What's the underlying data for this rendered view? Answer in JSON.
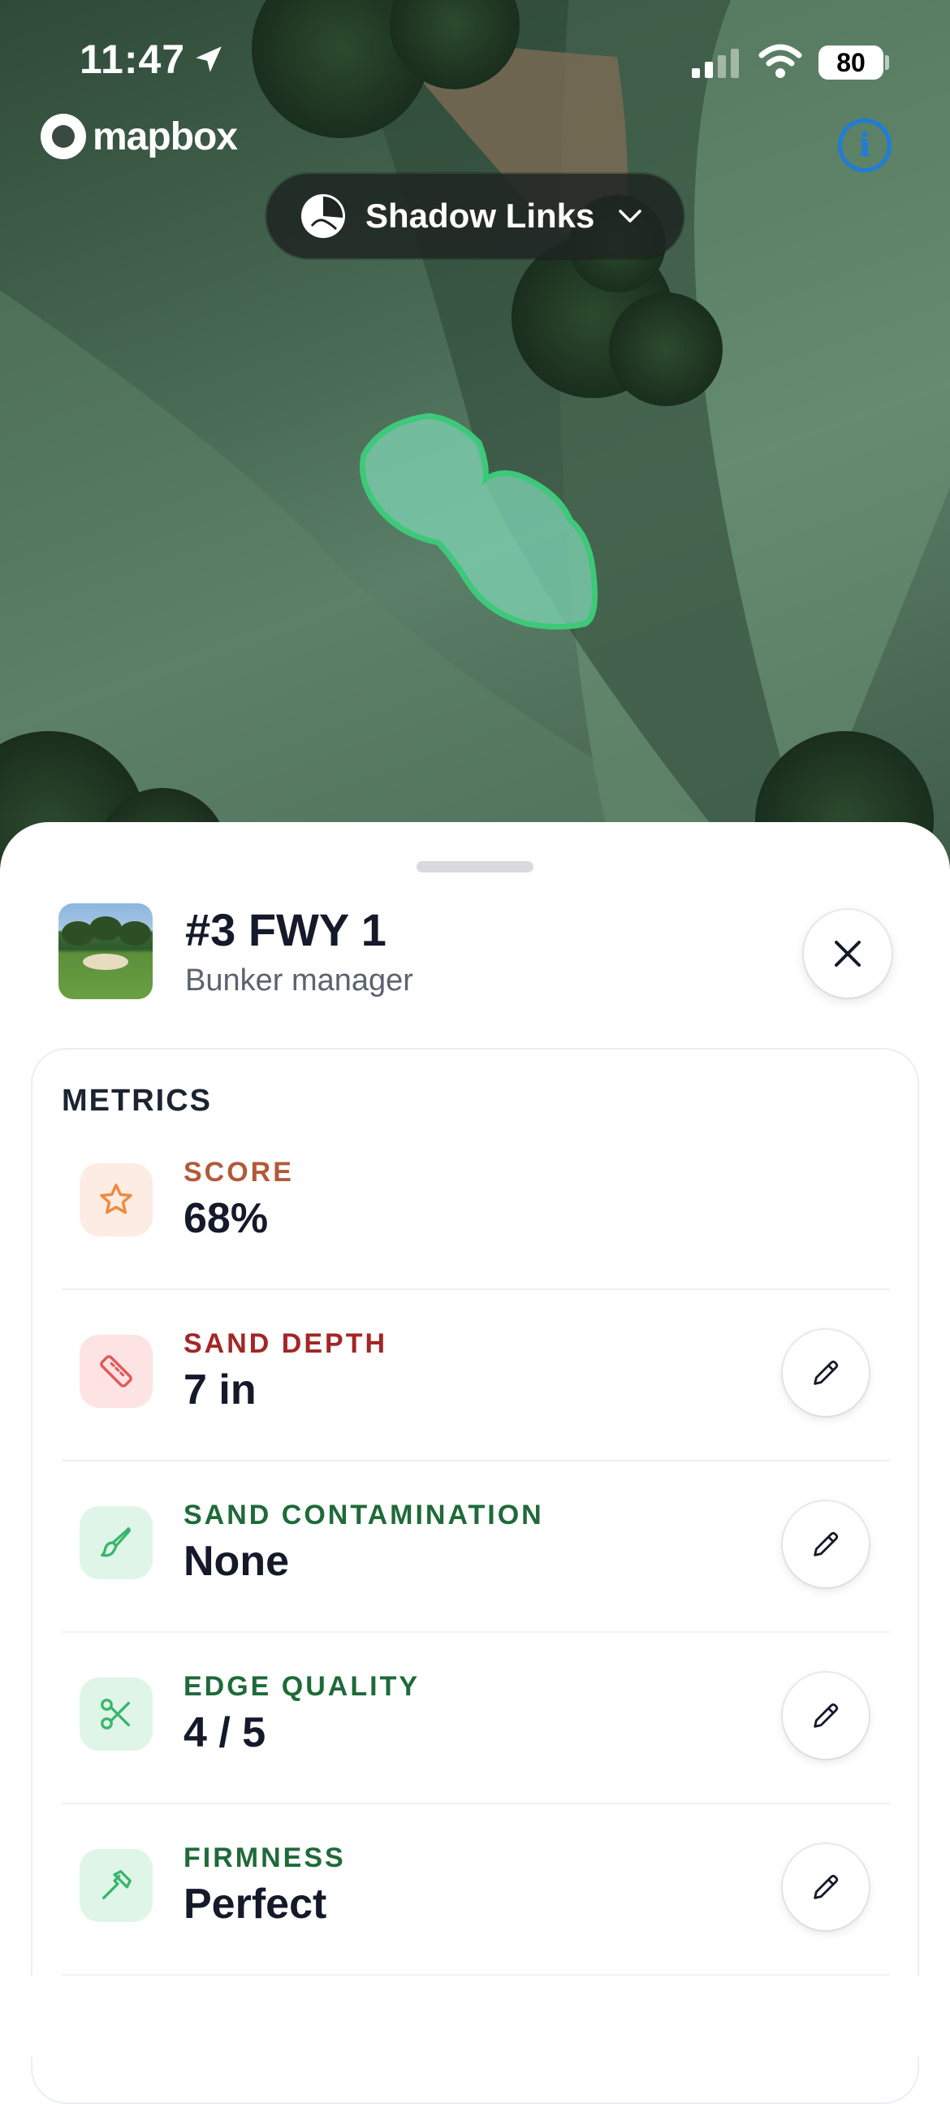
{
  "status_bar": {
    "time": "11:47",
    "battery": "80",
    "location_icon": "location-arrow-icon",
    "signal_icon": "cellular-signal-icon",
    "wifi_icon": "wifi-icon"
  },
  "map": {
    "attribution": "mapbox",
    "info_icon": "info-icon",
    "highlight_color": "#3ec97a"
  },
  "course_selector": {
    "label": "Shadow Links",
    "icon": "course-logo-icon",
    "chevron": "chevron-down-icon"
  },
  "sheet": {
    "title": "#3 FWY 1",
    "subtitle": "Bunker manager",
    "close_icon": "close-icon"
  },
  "metrics": {
    "section_title": "METRICS",
    "items": [
      {
        "label": "SCORE",
        "value": "68%",
        "icon": "star-icon",
        "label_color": "#b05a3a",
        "icon_color": "#f08a3c",
        "bg_color": "#fdece3",
        "editable": false
      },
      {
        "label": "SAND DEPTH",
        "value": "7 in",
        "icon": "ruler-icon",
        "label_color": "#a32626",
        "icon_color": "#e45757",
        "bg_color": "#fde3e3",
        "editable": true
      },
      {
        "label": "SAND CONTAMINATION",
        "value": "None",
        "icon": "brush-icon",
        "label_color": "#1f6a3a",
        "icon_color": "#38b56a",
        "bg_color": "#dff5e7",
        "editable": true
      },
      {
        "label": "EDGE QUALITY",
        "value": "4 / 5",
        "icon": "scissors-icon",
        "label_color": "#1f6a3a",
        "icon_color": "#38b56a",
        "bg_color": "#dff5e7",
        "editable": true
      },
      {
        "label": "FIRMNESS",
        "value": "Perfect",
        "icon": "hammer-icon",
        "label_color": "#1f6a3a",
        "icon_color": "#38b56a",
        "bg_color": "#dff5e7",
        "editable": true
      }
    ],
    "edit_icon": "pencil-icon"
  }
}
